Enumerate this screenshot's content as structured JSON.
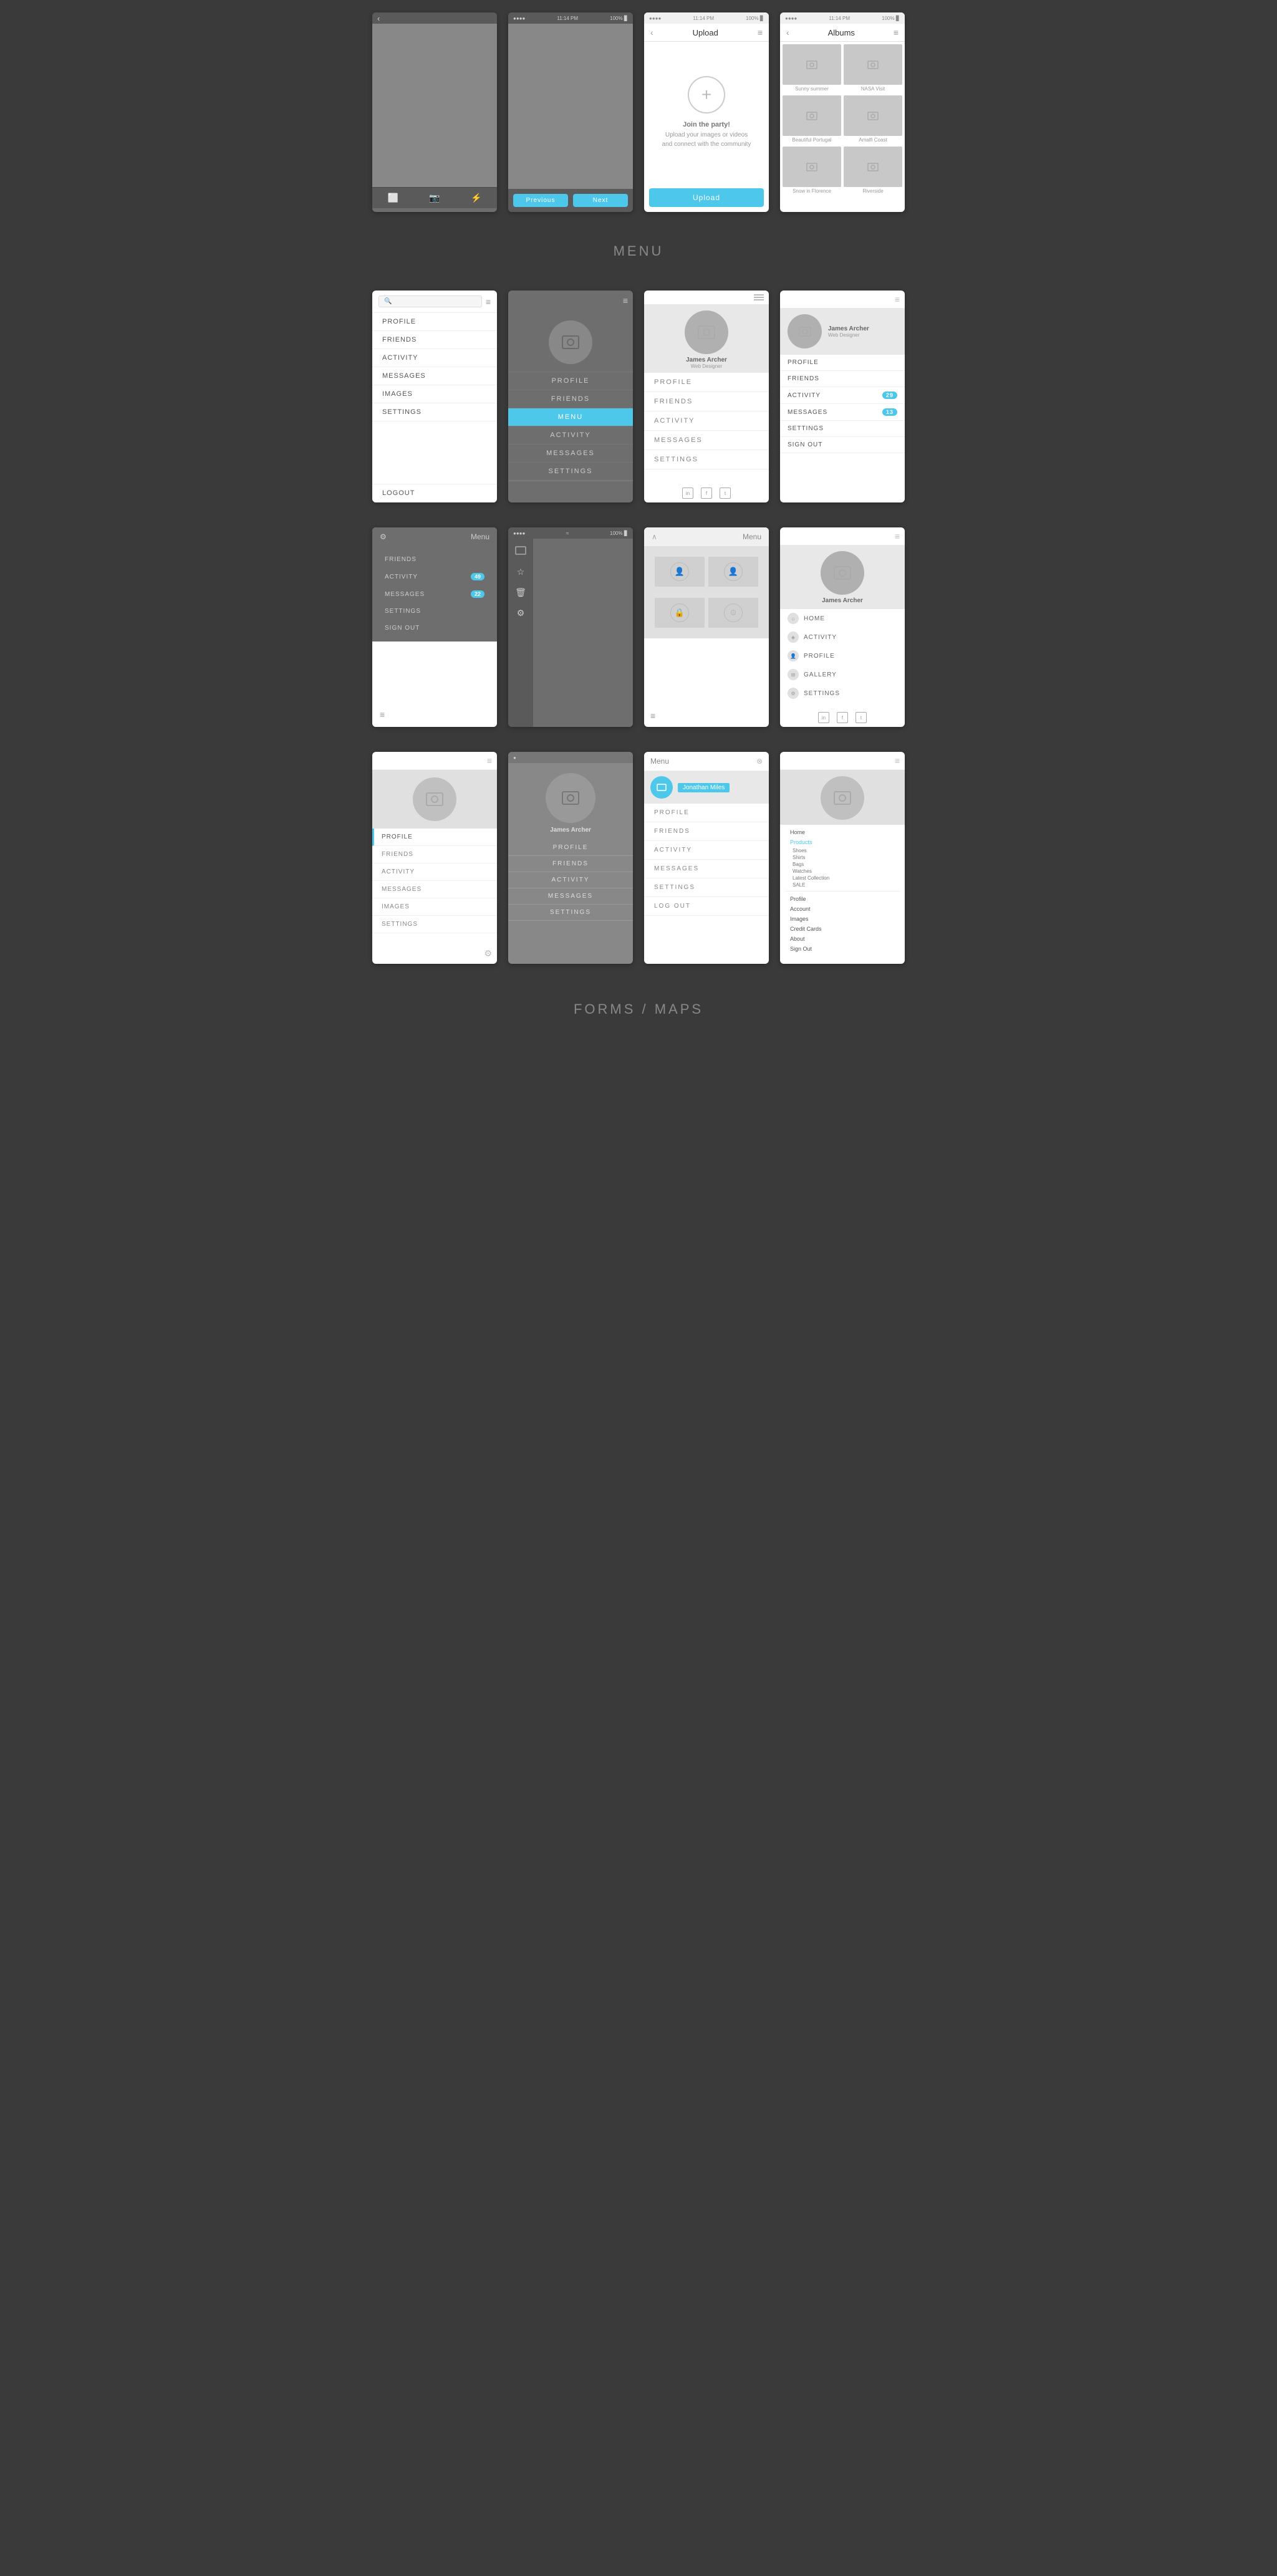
{
  "sections": {
    "menu_label": "MENU",
    "forms_label": "FORMS / MAPS"
  },
  "top_screens": [
    {
      "id": "camera-roll-dark",
      "type": "dark",
      "has_back": true,
      "has_bottom_toolbar": true,
      "toolbar_icons": [
        "image",
        "camera",
        "lightning"
      ]
    },
    {
      "id": "camera-roll-dark2",
      "type": "dark",
      "has_status": true,
      "status_time": "11:14 PM",
      "has_bottom_buttons": true,
      "buttons": [
        "Previous",
        "Next"
      ]
    },
    {
      "id": "upload",
      "type": "light",
      "has_status": true,
      "status_time": "11:14 PM",
      "nav_title": "Upload",
      "has_menu_icon": true,
      "upload_text_line1": "Join the party!",
      "upload_text_line2": "Upload your images or videos",
      "upload_text_line3": "and connect with the community",
      "upload_btn": "Upload"
    },
    {
      "id": "albums",
      "type": "light",
      "has_status": true,
      "status_time": "11:14 PM",
      "nav_title": "Albums",
      "has_menu_icon": true,
      "albums": [
        "Sunny summer",
        "NASA Visit",
        "Beautiful Portugal",
        "Amalfi Coast",
        "Snow in Florence",
        "Riverside"
      ]
    }
  ],
  "menu_row1": [
    {
      "id": "menu-search",
      "has_search": true,
      "has_hamburger": true,
      "items": [
        "PROFILE",
        "FRIENDS",
        "ACTIVITY",
        "MESSAGES",
        "IMAGES",
        "SETTINGS"
      ],
      "bottom_item": "LOGOUT"
    },
    {
      "id": "menu-dark-profile",
      "type": "dark",
      "has_hamburger": true,
      "profile_name": "",
      "items": [
        "PROFILE",
        "FRIENDS",
        "MENU",
        "ACTIVITY",
        "MESSAGES",
        "SETTINGS"
      ],
      "active_item": "MENU"
    },
    {
      "id": "menu-white-profile",
      "type": "light",
      "has_scroll": true,
      "profile_name": "James Archer",
      "profile_sub": "Web Designer",
      "items": [
        "PROFILE",
        "FRIENDS",
        "ACTIVITY",
        "MESSAGES",
        "SETTINGS"
      ],
      "has_social": true
    },
    {
      "id": "menu-profile-badges",
      "type": "light",
      "has_hamburger": true,
      "profile_name": "James Archer",
      "profile_sub": "Web Designer",
      "items_with_badges": [
        {
          "label": "PROFILE",
          "badge": null
        },
        {
          "label": "FRIENDS",
          "badge": null
        },
        {
          "label": "ACTIVITY",
          "badge": "29"
        },
        {
          "label": "MESSAGES",
          "badge": "13"
        },
        {
          "label": "SETTINGS",
          "badge": null
        },
        {
          "label": "SIGN OUT",
          "badge": null
        }
      ]
    }
  ],
  "menu_row2": [
    {
      "id": "menu-small-dark",
      "type": "dark_partial",
      "top_label": "Menu",
      "items_with_badges": [
        {
          "label": "FRIENDS",
          "badge": null
        },
        {
          "label": "ACTIVITY",
          "badge": "49"
        },
        {
          "label": "MESSAGES",
          "badge": "22"
        },
        {
          "label": "SETTINGS",
          "badge": null
        },
        {
          "label": "SIGN OUT",
          "badge": null
        }
      ],
      "has_hamburger_bottom": true
    },
    {
      "id": "menu-icon-sidebar",
      "type": "dark",
      "has_status": true,
      "icons": [
        "image",
        "star",
        "trash",
        "gear"
      ]
    },
    {
      "id": "menu-grid-icons",
      "type": "light_header",
      "top_label": "Menu",
      "has_collapse": true,
      "grid_icons": [
        "person",
        "person",
        "lock",
        "gear"
      ],
      "has_hamburger_bottom": true
    },
    {
      "id": "menu-icon-list",
      "type": "light",
      "has_hamburger": true,
      "profile_name": "James Archer",
      "items": [
        {
          "label": "HOME",
          "icon": "home"
        },
        {
          "label": "ACTIVITY",
          "icon": "activity"
        },
        {
          "label": "PROFILE",
          "icon": "profile"
        },
        {
          "label": "GALLERY",
          "icon": "gallery"
        },
        {
          "label": "SETTINGS",
          "icon": "settings"
        }
      ],
      "has_social": true
    }
  ],
  "menu_row3": [
    {
      "id": "menu-left-highlight",
      "type": "light",
      "has_hamburger": true,
      "profile_circle": true,
      "items": [
        "PROFILE",
        "FRIENDS",
        "ACTIVITY",
        "MESSAGES",
        "IMAGES",
        "SETTINGS"
      ],
      "active_item": "PROFILE",
      "has_gear_bottom": true
    },
    {
      "id": "menu-centered-dark",
      "type": "dark_bg",
      "has_dot": true,
      "profile_name": "James Archer",
      "items": [
        "PROFILE",
        "FRIENDS",
        "ACTIVITY",
        "MESSAGES",
        "SETTINGS"
      ]
    },
    {
      "id": "menu-search-top",
      "type": "light",
      "nav_title": "Menu",
      "has_close": true,
      "has_avatar_small": true,
      "avatar_name": "Jonathan Miles",
      "items": [
        "PROFILE",
        "FRIENDS",
        "ACTIVITY",
        "MESSAGES",
        "SETTINGS",
        "LOG OUT"
      ]
    },
    {
      "id": "menu-products",
      "type": "light",
      "has_hamburger": true,
      "profile_circle": true,
      "items_structured": [
        {
          "label": "Home",
          "type": "link"
        },
        {
          "label": "Products",
          "type": "link_blue"
        },
        {
          "label": "Shoes",
          "type": "sub"
        },
        {
          "label": "Shirts",
          "type": "sub"
        },
        {
          "label": "Bags",
          "type": "sub"
        },
        {
          "label": "Watches",
          "type": "sub"
        },
        {
          "label": "Latest Collection",
          "type": "sub"
        },
        {
          "label": "SALE",
          "type": "sub"
        },
        {
          "label": "Profile",
          "type": "link"
        },
        {
          "label": "Account",
          "type": "link"
        },
        {
          "label": "Images",
          "type": "link"
        },
        {
          "label": "Credit Cards",
          "type": "link"
        },
        {
          "label": "About",
          "type": "link"
        },
        {
          "label": "Sign Out",
          "type": "link"
        }
      ]
    }
  ],
  "badges": {
    "activity_29": "29",
    "messages_13": "13",
    "activity_49": "49",
    "messages_22": "22"
  },
  "nav": {
    "back": "‹",
    "menu": "≡",
    "close": "✕",
    "collapse": "∧"
  }
}
